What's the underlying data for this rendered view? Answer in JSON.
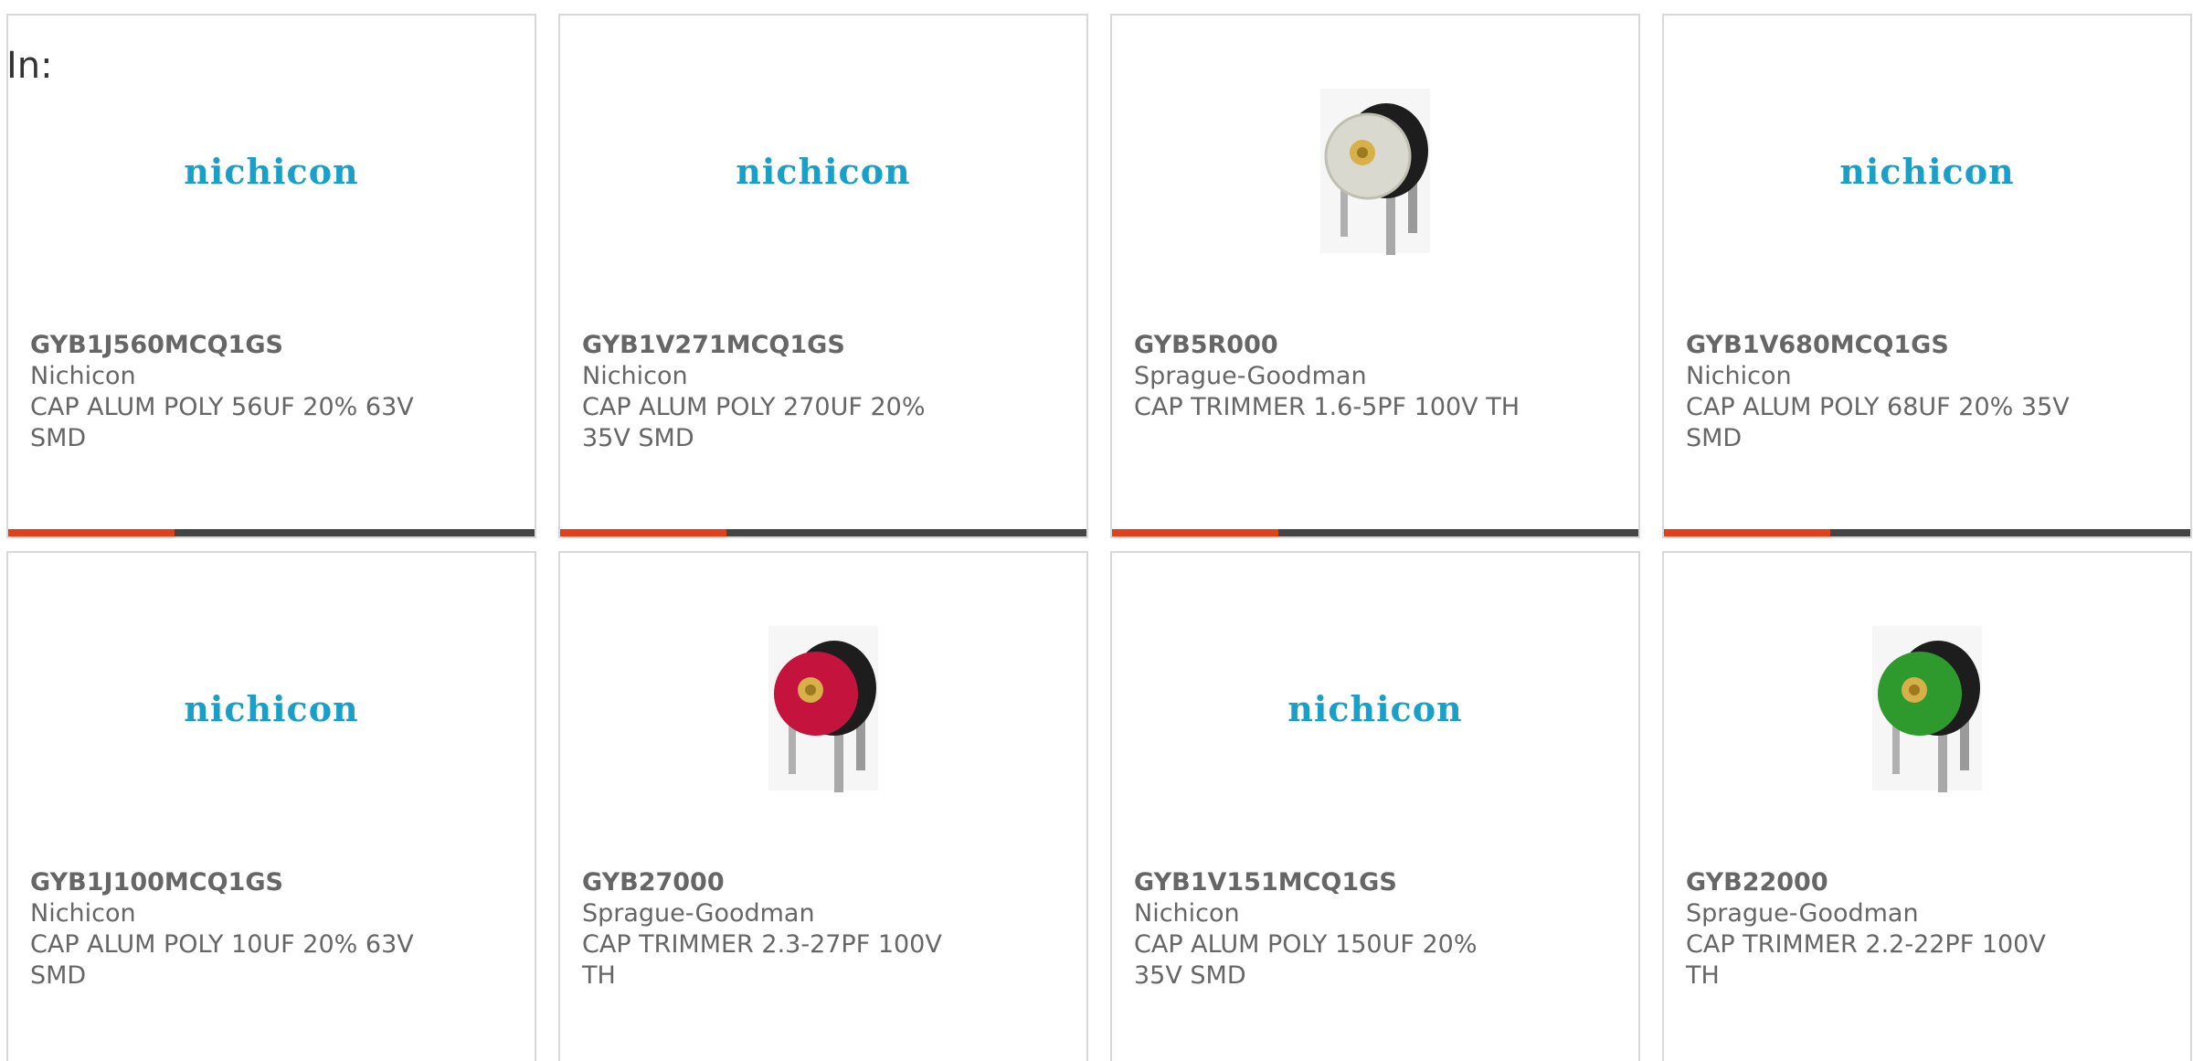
{
  "header": {
    "label": "In:"
  },
  "colors": {
    "logo": "#1aa0c8",
    "accent": "#e0401a",
    "bar": "#444444",
    "text": "#666666"
  },
  "products": [
    {
      "part": "GYB1J560MCQ1GS",
      "maker": "Nichicon",
      "desc": "CAP ALUM POLY 56UF 20% 63V SMD",
      "image": "nichicon-logo",
      "logo_text": "nichicon"
    },
    {
      "part": "GYB1V271MCQ1GS",
      "maker": "Nichicon",
      "desc": "CAP ALUM POLY 270UF 20% 35V SMD",
      "image": "nichicon-logo",
      "logo_text": "nichicon"
    },
    {
      "part": "GYB5R000",
      "maker": "Sprague-Goodman",
      "desc": "CAP TRIMMER 1.6-5PF 100V TH",
      "image": "trimmer-capacitor-clear"
    },
    {
      "part": "GYB1V680MCQ1GS",
      "maker": "Nichicon",
      "desc": "CAP ALUM POLY 68UF 20% 35V SMD",
      "image": "nichicon-logo",
      "logo_text": "nichicon"
    },
    {
      "part": "GYB1J100MCQ1GS",
      "maker": "Nichicon",
      "desc": "CAP ALUM POLY 10UF 20% 63V SMD",
      "image": "nichicon-logo",
      "logo_text": "nichicon"
    },
    {
      "part": "GYB27000",
      "maker": "Sprague-Goodman",
      "desc": "CAP TRIMMER 2.3-27PF 100V TH",
      "image": "trimmer-capacitor-red"
    },
    {
      "part": "GYB1V151MCQ1GS",
      "maker": "Nichicon",
      "desc": "CAP ALUM POLY 150UF 20% 35V SMD",
      "image": "nichicon-logo",
      "logo_text": "nichicon"
    },
    {
      "part": "GYB22000",
      "maker": "Sprague-Goodman",
      "desc": "CAP TRIMMER 2.2-22PF 100V TH",
      "image": "trimmer-capacitor-green"
    }
  ]
}
